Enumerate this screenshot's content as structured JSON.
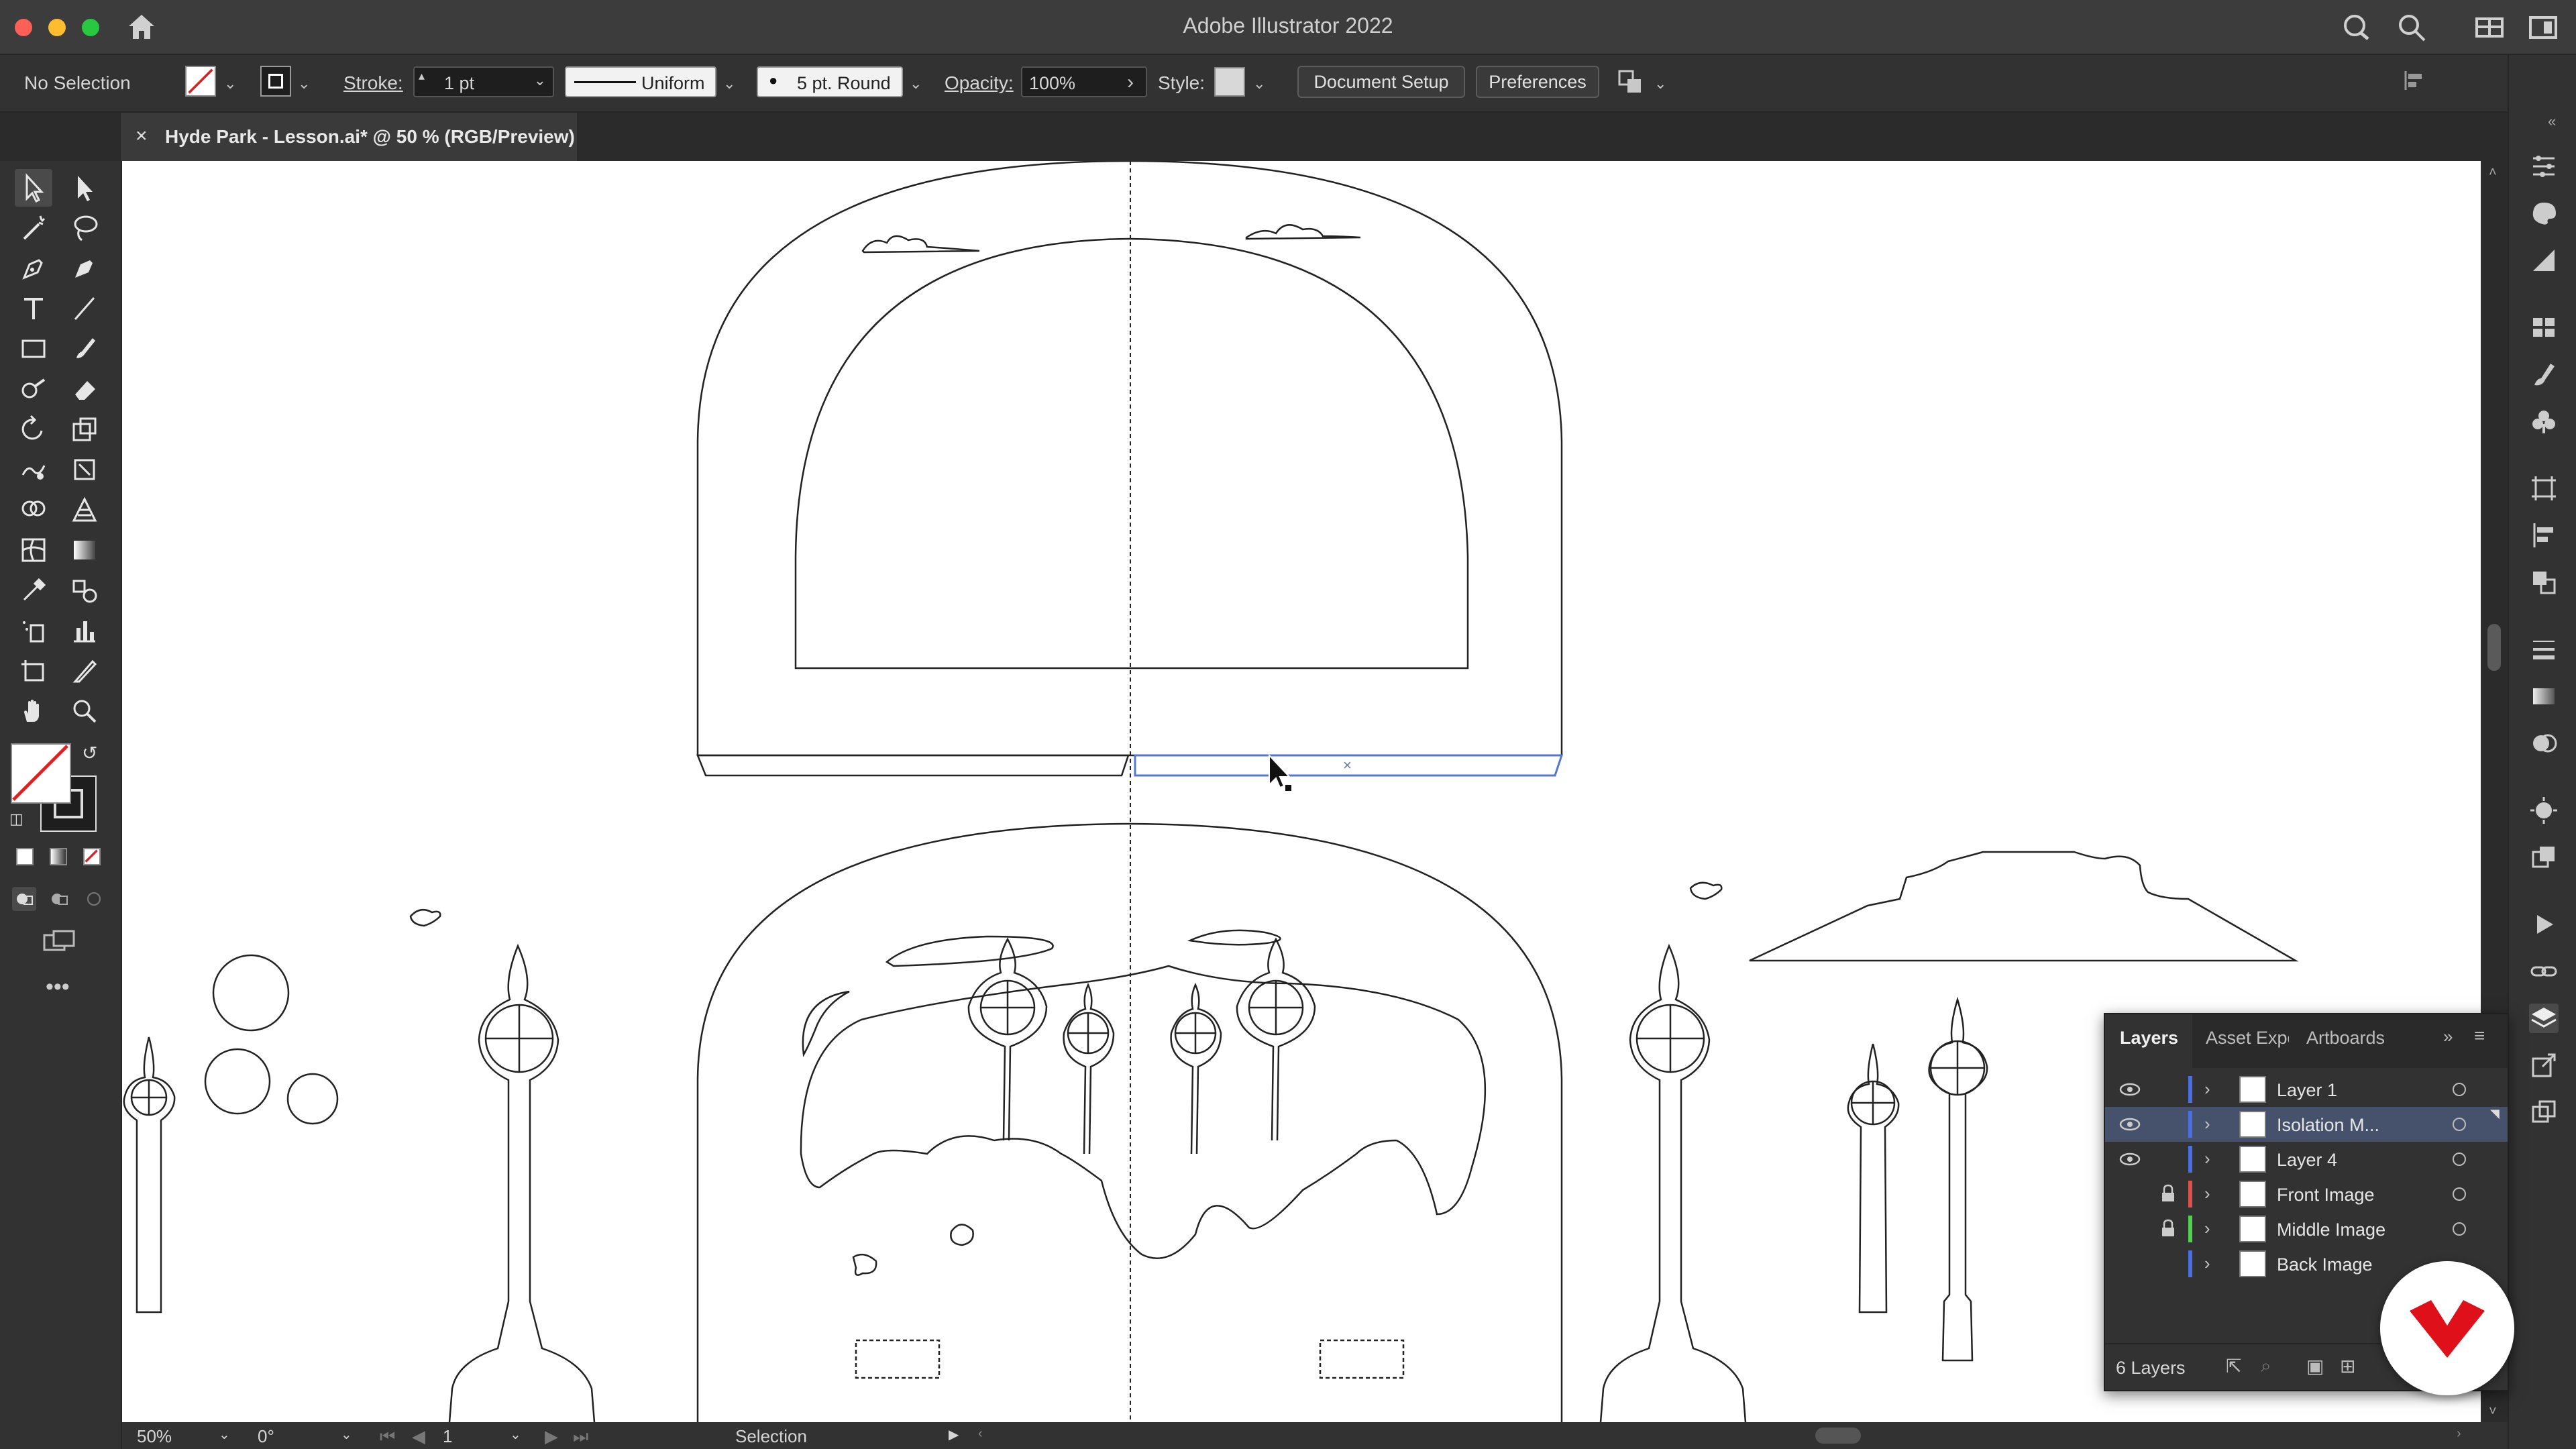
{
  "app": {
    "title": "Adobe Illustrator 2022"
  },
  "control_bar": {
    "selection_label": "No Selection",
    "stroke_label": "Stroke:",
    "stroke_weight": "1 pt",
    "stroke_profile": "Uniform",
    "brush": "5 pt. Round",
    "opacity_label": "Opacity:",
    "opacity_value": "100%",
    "style_label": "Style:",
    "document_setup_button": "Document Setup",
    "preferences_button": "Preferences"
  },
  "document_tab": {
    "label": "Hyde Park - Lesson.ai* @ 50 % (RGB/Preview)"
  },
  "status_bar": {
    "zoom": "50%",
    "rotation": "0°",
    "artboard_number": "1",
    "current_tool": "Selection"
  },
  "layers_panel": {
    "tabs": [
      "Layers",
      "Asset Expo",
      "Artboards"
    ],
    "layers": [
      {
        "name": "Layer 1",
        "visible": true,
        "locked": false,
        "color": "#4a6fe0"
      },
      {
        "name": "Isolation M...",
        "visible": true,
        "locked": false,
        "color": "#4a6fe0",
        "selected": true
      },
      {
        "name": "Layer 4",
        "visible": true,
        "locked": false,
        "color": "#4a6fe0"
      },
      {
        "name": "Front Image",
        "visible": false,
        "locked": true,
        "color": "#e0504a"
      },
      {
        "name": "Middle Image",
        "visible": false,
        "locked": true,
        "color": "#4fd04f"
      },
      {
        "name": "Back Image",
        "visible": false,
        "locked": false,
        "color": "#4a6fe0"
      }
    ],
    "layer_count": "6 Layers"
  },
  "colors": {
    "accent": "#4a6fe0",
    "brand": "#e0101a",
    "selection_stroke": "#5577cc"
  }
}
